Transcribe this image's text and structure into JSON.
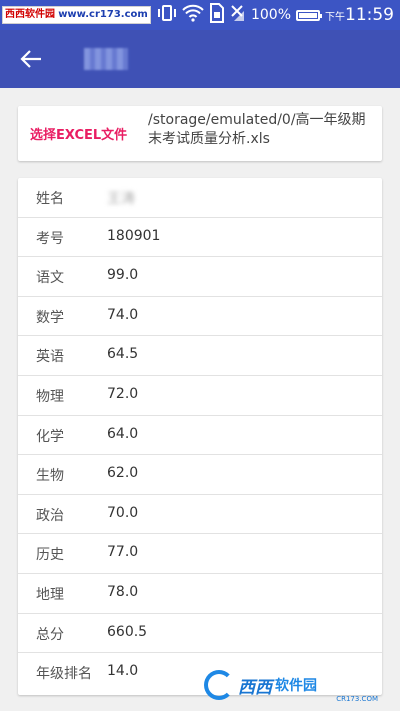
{
  "status_bar": {
    "watermark_cn": "西西软件园",
    "watermark_url": "www.cr173.com",
    "battery": "100%",
    "ampm": "下午",
    "time": "11:59"
  },
  "appbar": {
    "title": "成绩"
  },
  "file": {
    "select_label": "选择EXCEL文件",
    "path": "/storage/emulated/0/高一年级期末考试质量分析.xls"
  },
  "records": [
    {
      "label": "姓名",
      "value": "王涛"
    },
    {
      "label": "考号",
      "value": "180901"
    },
    {
      "label": "语文",
      "value": "99.0"
    },
    {
      "label": "数学",
      "value": "74.0"
    },
    {
      "label": "英语",
      "value": "64.5"
    },
    {
      "label": "物理",
      "value": "72.0"
    },
    {
      "label": "化学",
      "value": "64.0"
    },
    {
      "label": "生物",
      "value": "62.0"
    },
    {
      "label": "政治",
      "value": "70.0"
    },
    {
      "label": "历史",
      "value": "77.0"
    },
    {
      "label": "地理",
      "value": "78.0"
    },
    {
      "label": "总分",
      "value": "660.5"
    },
    {
      "label": "年级排名",
      "value": "14.0"
    }
  ],
  "logo": {
    "brand": "西西",
    "name": "软件园",
    "url": "CR173.COM"
  },
  "colors": {
    "primary": "#3f51b5",
    "accent": "#e91e63"
  }
}
